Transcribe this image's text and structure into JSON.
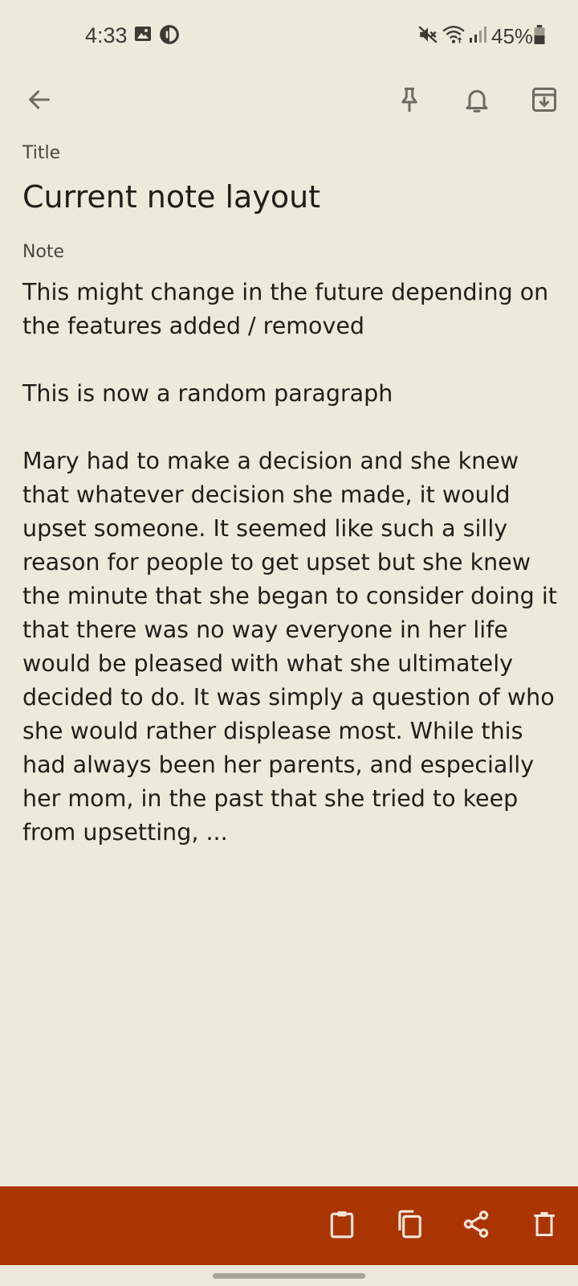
{
  "status_bar": {
    "time": "4:33",
    "battery": "45%",
    "icons": [
      "image-icon",
      "data-saver-icon",
      "mute-icon",
      "wifi-icon",
      "signal-icon",
      "battery-icon"
    ]
  },
  "toolbar": {
    "icons": [
      "back-arrow-icon",
      "pin-icon",
      "bell-icon",
      "archive-icon"
    ]
  },
  "note": {
    "title_label": "Title",
    "title": "Current note layout",
    "body_label": "Note",
    "body": "This might change in the future depending on the features added / removed\n\nThis is now a random paragraph\n\nMary had to make a decision and she knew that whatever decision she made, it would upset someone. It seemed like such a silly reason for people to get upset but she knew the minute that she began to consider doing it that there was no way everyone in her life would be pleased with what she ultimately decided to do. It was simply a question of who she would rather displease most. While this had always been her parents, and especially her mom, in the past that she tried to keep from upsetting, ..."
  },
  "bottom_bar": {
    "icons": [
      "clipboard-icon",
      "copy-icon",
      "share-icon",
      "delete-icon"
    ]
  },
  "colors": {
    "background": "#edeadb",
    "bottom_bar": "#ab3500",
    "text": "#211d18",
    "secondary_text": "#4b4640",
    "icon": "#6f6a62",
    "bottom_icon": "#f2e6dc"
  }
}
